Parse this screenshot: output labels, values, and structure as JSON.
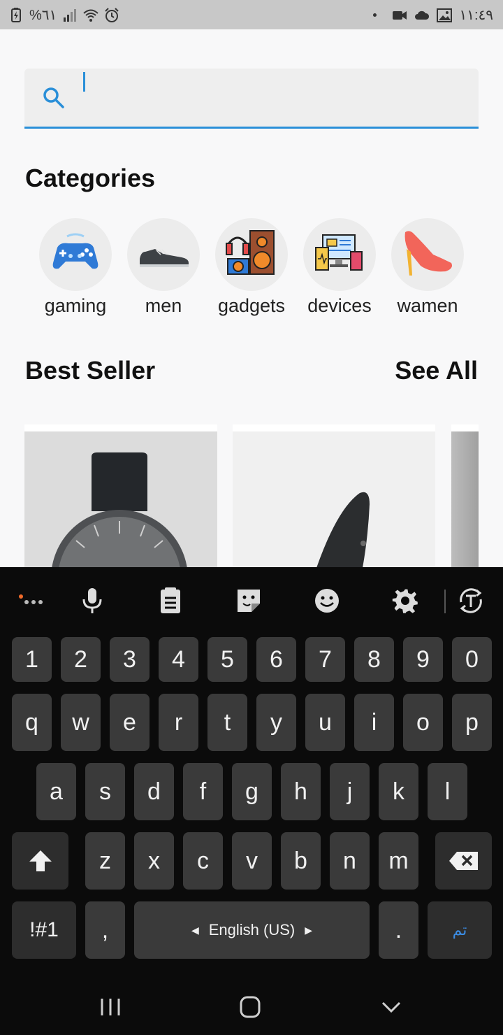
{
  "status_bar": {
    "battery": "%٦١",
    "time": "١١:٤٩"
  },
  "search": {
    "placeholder": "",
    "value": ""
  },
  "categories": {
    "title": "Categories",
    "items": [
      {
        "label": "gaming",
        "icon": "gamepad-icon"
      },
      {
        "label": "men",
        "icon": "sneaker-icon"
      },
      {
        "label": "gadgets",
        "icon": "gadgets-icon"
      },
      {
        "label": "devices",
        "icon": "devices-icon"
      },
      {
        "label": "wamen",
        "icon": "high-heel-icon"
      }
    ]
  },
  "best_seller": {
    "title": "Best Seller",
    "see_all": "See All"
  },
  "keyboard": {
    "number_row": [
      "1",
      "2",
      "3",
      "4",
      "5",
      "6",
      "7",
      "8",
      "9",
      "0"
    ],
    "row1": [
      "q",
      "w",
      "e",
      "r",
      "t",
      "y",
      "u",
      "i",
      "o",
      "p"
    ],
    "row2": [
      "a",
      "s",
      "d",
      "f",
      "g",
      "h",
      "j",
      "k",
      "l"
    ],
    "row3": [
      "z",
      "x",
      "c",
      "v",
      "b",
      "n",
      "m"
    ],
    "symbols_key": "!#1",
    "comma_key": ",",
    "space_label": "English (US)",
    "period_key": ".",
    "done_key": "تم"
  },
  "colors": {
    "accent": "#2a8fd8",
    "keyboard_bg": "#0b0b0b",
    "key_bg": "#3a3a3a"
  }
}
